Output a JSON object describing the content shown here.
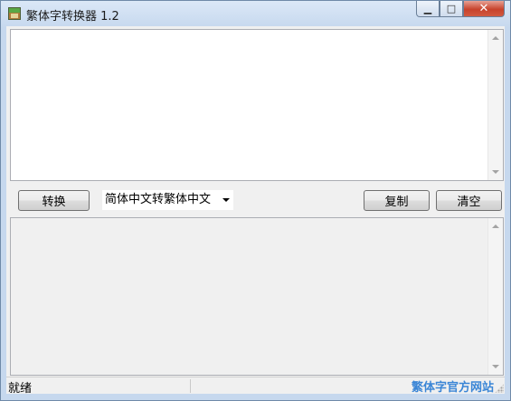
{
  "window": {
    "title": "繁体字转换器 1.2",
    "buttons": {
      "minimize": "▁",
      "maximize": "□",
      "close": "✕"
    }
  },
  "toolbar": {
    "convert_label": "转换",
    "mode_select": {
      "selected": "简体中文转繁体中文"
    },
    "copy_label": "复制",
    "clear_label": "清空"
  },
  "input": {
    "value": ""
  },
  "output": {
    "value": ""
  },
  "statusbar": {
    "status": "就绪",
    "link": "繁体字官方网站"
  },
  "colors": {
    "link": "#3b86d6",
    "close_button": "#c7432c"
  }
}
